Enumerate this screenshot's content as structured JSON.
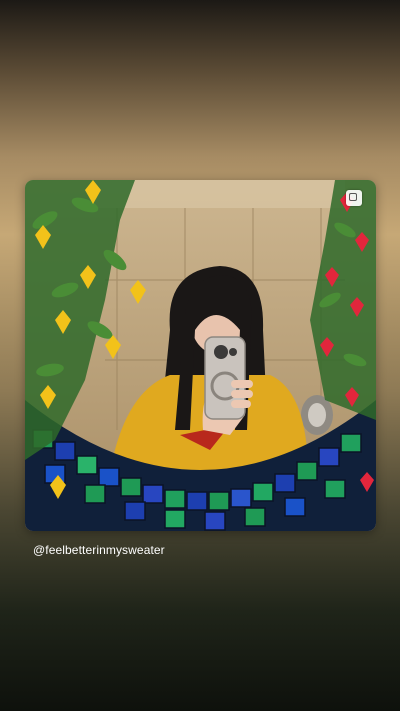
{
  "story": {
    "mention": "@feelbetterinmysweater",
    "photo_icon": "square-frame-icon"
  },
  "colors": {
    "shirt": "#e0a91f",
    "hair": "#1a1716",
    "phone": "#c9c3bd",
    "tile_wall": "#b9a27d",
    "mosaic_blue": "#1d3fb0",
    "mosaic_green": "#1f9a55",
    "leaf": "#2f6a2a",
    "yellow_flower": "#f2c21a",
    "red_flower": "#e2263c"
  }
}
